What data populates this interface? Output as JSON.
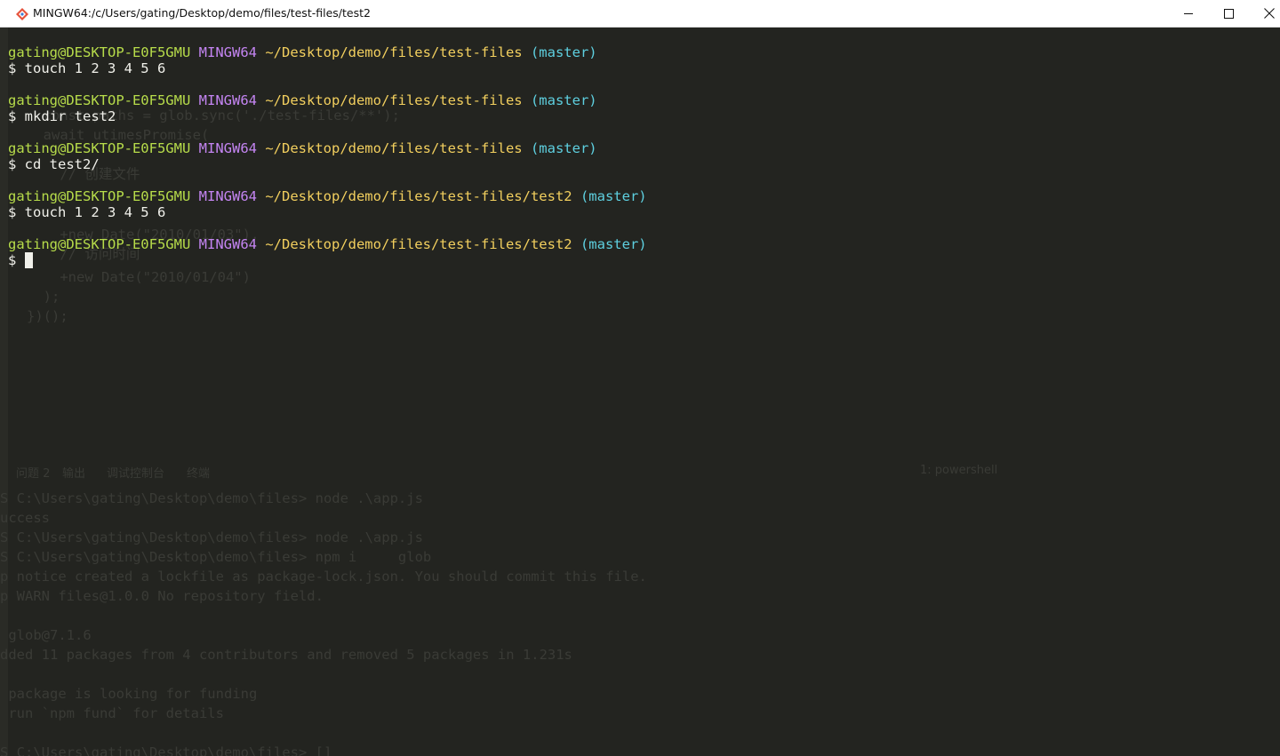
{
  "window": {
    "title": "MINGW64:/c/Users/gating/Desktop/demo/files/test-files/test2",
    "icon": "git-bash-icon",
    "controls": [
      "minimize-icon",
      "maximize-icon",
      "close-icon"
    ]
  },
  "colors": {
    "user": "#b7dc4a",
    "host": "#c485f2",
    "path": "#f2cf5e",
    "branch": "#5ed0e0",
    "text": "#f0f0ea",
    "background": "#232420"
  },
  "terminal": {
    "blocks": [
      {
        "prompt": {
          "user": "gating@DESKTOP-E0F5GMU",
          "host": "MINGW64",
          "path": "~/Desktop/demo/files/test-files",
          "branch": "(master)"
        },
        "command": "$ touch 1 2 3 4 5 6"
      },
      {
        "prompt": {
          "user": "gating@DESKTOP-E0F5GMU",
          "host": "MINGW64",
          "path": "~/Desktop/demo/files/test-files",
          "branch": "(master)"
        },
        "command": "$ mkdir test2"
      },
      {
        "prompt": {
          "user": "gating@DESKTOP-E0F5GMU",
          "host": "MINGW64",
          "path": "~/Desktop/demo/files/test-files",
          "branch": "(master)"
        },
        "command": "$ cd test2/"
      },
      {
        "prompt": {
          "user": "gating@DESKTOP-E0F5GMU",
          "host": "MINGW64",
          "path": "~/Desktop/demo/files/test-files/test2",
          "branch": "(master)"
        },
        "command": "$ touch 1 2 3 4 5 6"
      },
      {
        "prompt": {
          "user": "gating@DESKTOP-E0F5GMU",
          "host": "MINGW64",
          "path": "~/Desktop/demo/files/test-files/test2",
          "branch": "(master)"
        },
        "command": "$ "
      }
    ]
  },
  "background_ghost": {
    "editor_lines": [
      "  const paths = glob.sync('./test-files/**');",
      "  await utimesPromise(",
      "    // 创建文件",
      "    +new Date(\"2010/01/03\"),",
      "    // 访问时间",
      "    +new Date(\"2010/01/04\")",
      "  );",
      "})();"
    ],
    "panel_tabs": [
      "问题 2",
      "输出",
      "调试控制台",
      "终端"
    ],
    "panel_right": "1: powershell",
    "terminal_lines": [
      "S C:\\Users\\gating\\Desktop\\demo\\files> node .\\app.js",
      "uccess",
      "S C:\\Users\\gating\\Desktop\\demo\\files> node .\\app.js",
      "S C:\\Users\\gating\\Desktop\\demo\\files> npm i     glob",
      "p notice created a lockfile as package-lock.json. You should commit this file.",
      "p WARN files@1.0.0 No repository field.",
      "",
      " glob@7.1.6",
      "dded 11 packages from 4 contributors and removed 5 packages in 1.231s",
      "",
      " package is looking for funding",
      " run `npm fund` for details",
      "",
      "S C:\\Users\\gating\\Desktop\\demo\\files> []"
    ]
  }
}
